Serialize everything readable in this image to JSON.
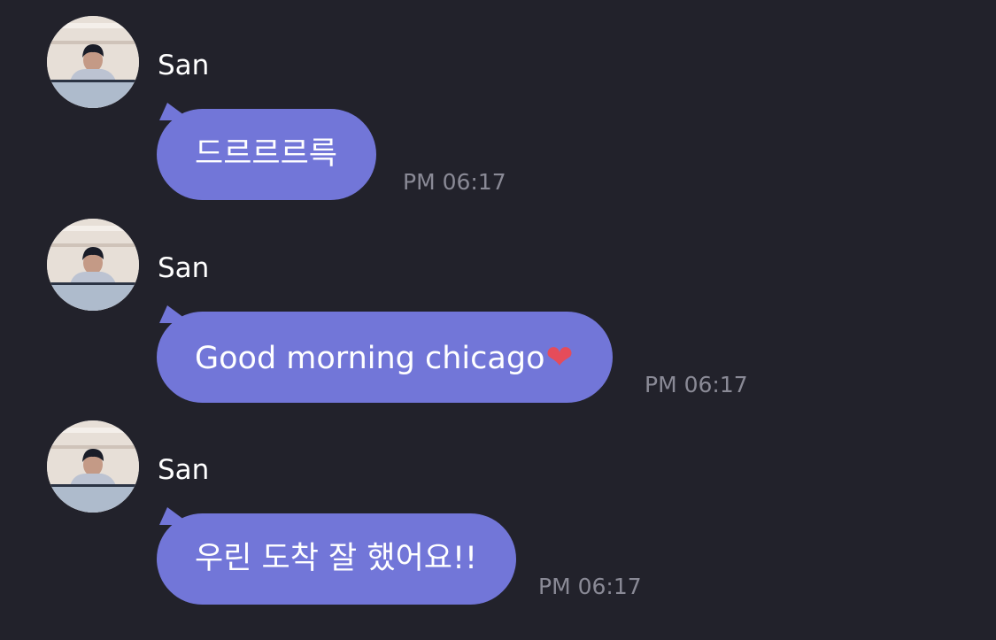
{
  "chat": {
    "messages": [
      {
        "sender": "San",
        "text": "드르르르륵",
        "time": "PM 06:17",
        "avatar_icon": "profile-photo"
      },
      {
        "sender": "San",
        "text": "Good morning chicago",
        "emoji": "❤",
        "time": "PM 06:17",
        "avatar_icon": "profile-photo"
      },
      {
        "sender": "San",
        "text": "우린 도착 잘 했어요!!",
        "time": "PM 06:17",
        "avatar_icon": "profile-photo"
      }
    ]
  },
  "colors": {
    "background": "#22222b",
    "bubble": "#7276d8",
    "timestamp": "#8a8a96",
    "heart": "#e54c5a"
  }
}
